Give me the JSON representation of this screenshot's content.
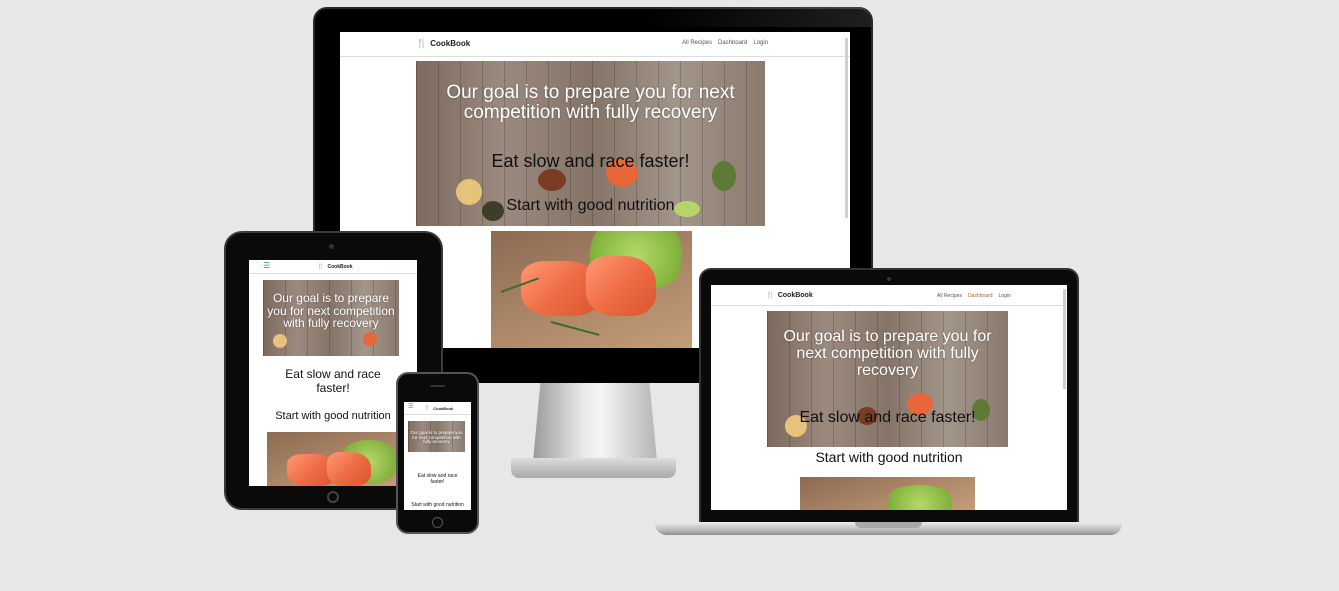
{
  "site": {
    "brand": "CookBook",
    "brand_icon": "fork-knife-icon",
    "nav_links": [
      "All Recipes",
      "Dashboard",
      "Login"
    ],
    "hero_title": "Our goal is to prepare you for next competition with fully recovery",
    "hero_subtitle": "Eat slow and race faster!",
    "section_text": "Start with good nutrition",
    "hamburger_icon": "hamburger-menu-icon"
  },
  "colors": {
    "background": "#e7e7e7",
    "device_black": "#0a0a0a",
    "silver": "#c9c9c9",
    "hamburger": "#1aa38a"
  }
}
